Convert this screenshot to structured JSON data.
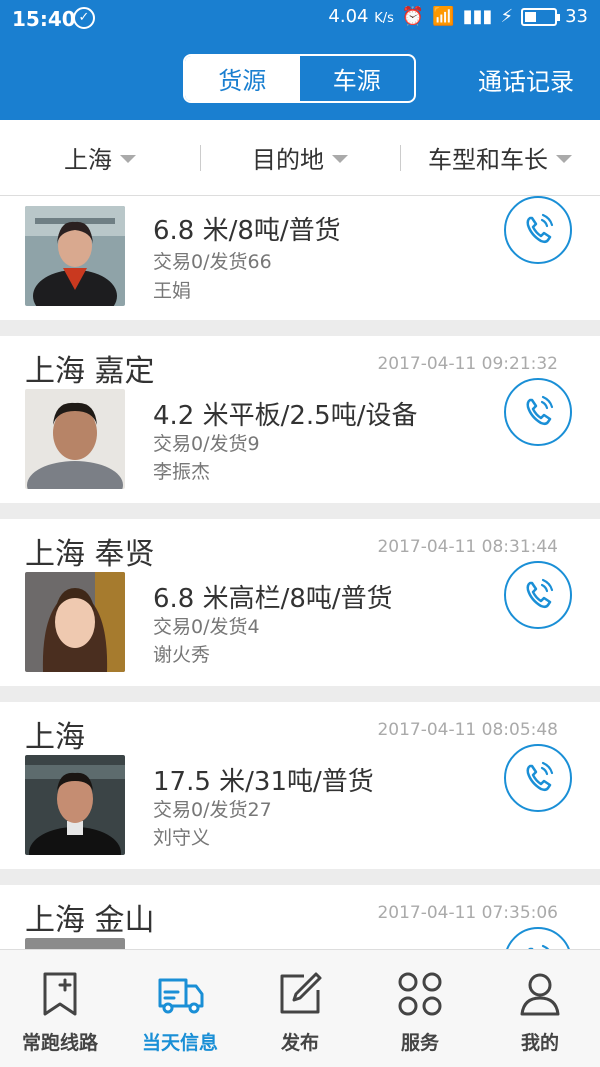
{
  "status_bar": {
    "time": "15:40",
    "net_speed": "4.04",
    "net_unit": "K/s",
    "battery": "33"
  },
  "header": {
    "tabs": [
      {
        "label": "货源",
        "active": true
      },
      {
        "label": "车源",
        "active": false
      }
    ],
    "call_log": "通话记录"
  },
  "filters": [
    {
      "label": "上海"
    },
    {
      "label": "目的地"
    },
    {
      "label": "车型和车长"
    }
  ],
  "cards": [
    {
      "region": "",
      "date": "",
      "spec": "6.8 米/8吨/普货",
      "trade": "交易0/发货66",
      "contact": "王娟"
    },
    {
      "region": "上海 嘉定",
      "date": "2017-04-11 09:21:32",
      "spec": "4.2 米平板/2.5吨/设备",
      "trade": "交易0/发货9",
      "contact": "李振杰"
    },
    {
      "region": "上海 奉贤",
      "date": "2017-04-11 08:31:44",
      "spec": "6.8 米高栏/8吨/普货",
      "trade": "交易0/发货4",
      "contact": "谢火秀"
    },
    {
      "region": "上海",
      "date": "2017-04-11 08:05:48",
      "spec": "17.5 米/31吨/普货",
      "trade": "交易0/发货27",
      "contact": "刘守义"
    },
    {
      "region": "上海 金山",
      "date": "2017-04-11 07:35:06",
      "spec": "",
      "trade": "",
      "contact": ""
    }
  ],
  "bottom_nav": [
    {
      "label": "常跑线路",
      "icon": "bookmark-plus-icon",
      "active": false
    },
    {
      "label": "当天信息",
      "icon": "truck-icon",
      "active": true
    },
    {
      "label": "发布",
      "icon": "edit-icon",
      "active": false
    },
    {
      "label": "服务",
      "icon": "grid-icon",
      "active": false
    },
    {
      "label": "我的",
      "icon": "person-icon",
      "active": false
    }
  ],
  "colors": {
    "primary": "#1a7fd0",
    "accent": "#1a8fd6"
  }
}
